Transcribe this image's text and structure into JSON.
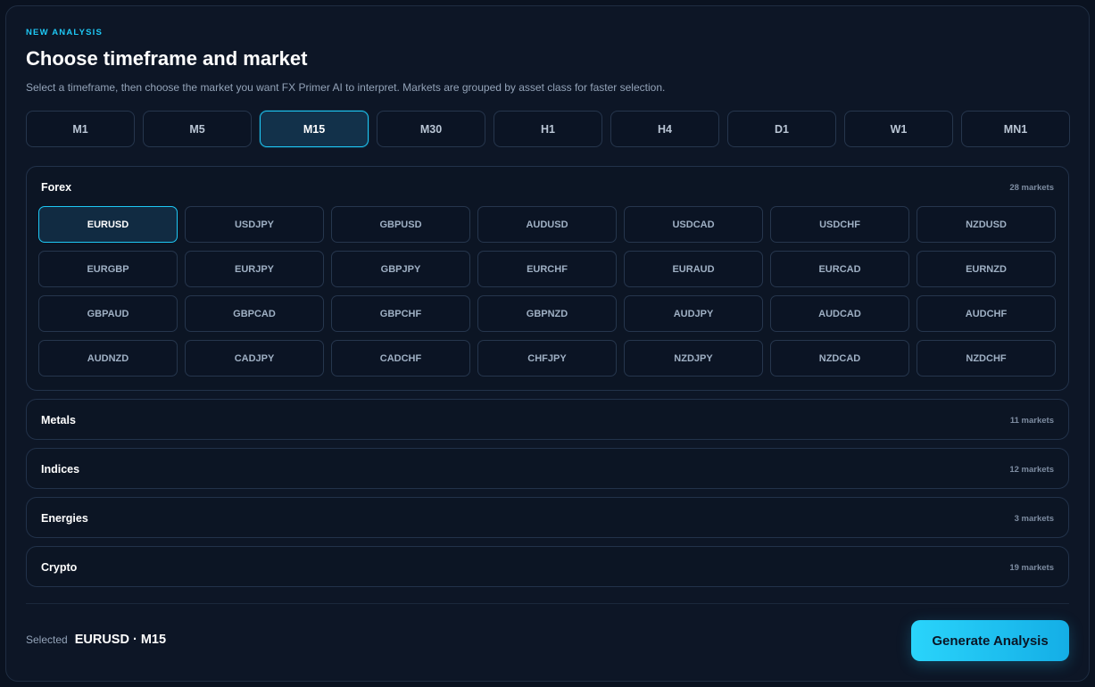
{
  "header": {
    "eyebrow": "NEW ANALYSIS",
    "title": "Choose timeframe and market",
    "subtitle": "Select a timeframe, then choose the market you want FX Primer AI to interpret. Markets are grouped by asset class for faster selection."
  },
  "timeframes": [
    "M1",
    "M5",
    "M15",
    "M30",
    "H1",
    "H4",
    "D1",
    "W1",
    "MN1"
  ],
  "selected_timeframe": "M15",
  "groups": {
    "forex": {
      "name": "Forex",
      "count": "28 markets",
      "markets": [
        "EURUSD",
        "USDJPY",
        "GBPUSD",
        "AUDUSD",
        "USDCAD",
        "USDCHF",
        "NZDUSD",
        "EURGBP",
        "EURJPY",
        "GBPJPY",
        "EURCHF",
        "EURAUD",
        "EURCAD",
        "EURNZD",
        "GBPAUD",
        "GBPCAD",
        "GBPCHF",
        "GBPNZD",
        "AUDJPY",
        "AUDCAD",
        "AUDCHF",
        "AUDNZD",
        "CADJPY",
        "CADCHF",
        "CHFJPY",
        "NZDJPY",
        "NZDCAD",
        "NZDCHF"
      ]
    },
    "metals": {
      "name": "Metals",
      "count": "11 markets"
    },
    "indices": {
      "name": "Indices",
      "count": "12 markets"
    },
    "energies": {
      "name": "Energies",
      "count": "3 markets"
    },
    "crypto": {
      "name": "Crypto",
      "count": "19 markets"
    }
  },
  "selected_market": "EURUSD",
  "footer": {
    "selected_label": "Selected",
    "selected_value": "EURUSD · M15",
    "generate_label": "Generate Analysis"
  },
  "colors": {
    "accent": "#1ec8f5",
    "background": "#0d1626"
  }
}
